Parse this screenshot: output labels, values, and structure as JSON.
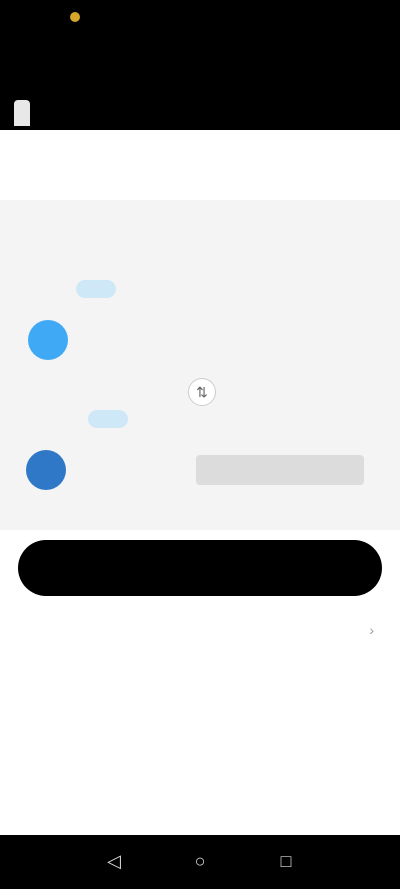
{
  "status": {
    "time": "",
    "indicators": ""
  },
  "header": {
    "title": "",
    "logo_text": ""
  },
  "topnav": [
    {
      "label": ""
    },
    {
      "label": ""
    },
    {
      "label": ""
    },
    {
      "label": ""
    }
  ],
  "tabs": [
    {
      "label": ""
    },
    {
      "label": ""
    },
    {
      "label": ""
    }
  ],
  "pay": {
    "label": "",
    "badge": "",
    "asset": "",
    "amount": ""
  },
  "swap_icon": "swap-arrows",
  "receive": {
    "label": "",
    "badge": "",
    "asset": "",
    "amount": ""
  },
  "cta_label": "",
  "rate": {
    "text": ""
  },
  "section": {
    "title": "",
    "body": ""
  },
  "colors": {
    "accent_badge": "#cfe8f7",
    "coin1": "#3fa9f5",
    "coin2": "#2f78c8",
    "cta": "#000000"
  },
  "navbar": {
    "icons": [
      "back-icon",
      "home-icon",
      "recents-icon"
    ]
  }
}
